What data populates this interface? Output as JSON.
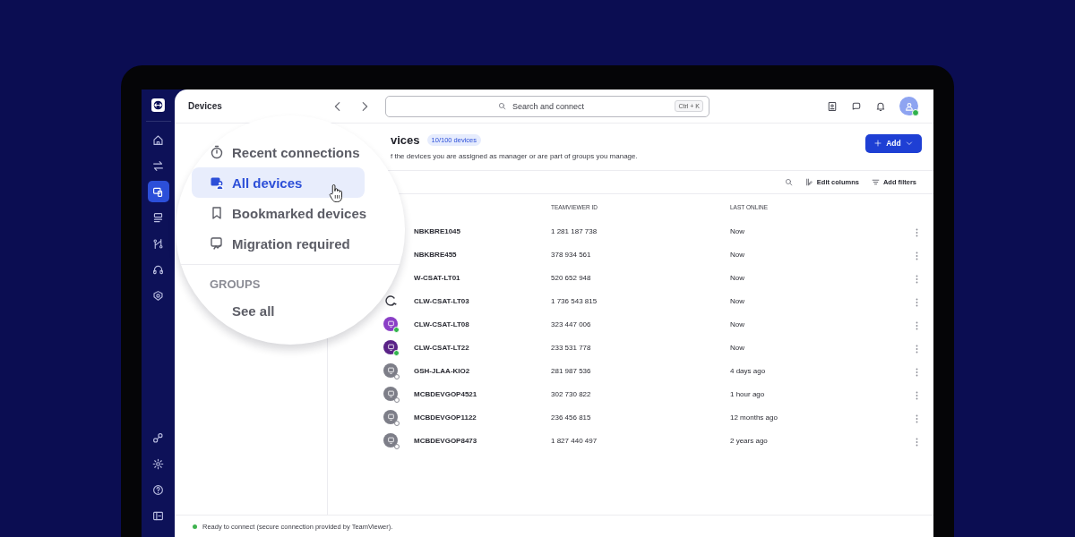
{
  "header": {
    "title": "Devices",
    "search": {
      "placeholder": "Search and connect",
      "shortcut": "Ctrl + K"
    },
    "avatar": {
      "online": true
    }
  },
  "rail": {
    "top": [
      {
        "selected": false
      },
      {
        "selected": false
      },
      {
        "selected": true
      },
      {
        "selected": false
      },
      {
        "selected": false
      },
      {
        "selected": false
      },
      {
        "selected": false
      }
    ],
    "bottom": [
      {
        "selected": false
      },
      {
        "selected": false
      },
      {
        "selected": false
      },
      {
        "selected": false
      }
    ]
  },
  "magnifier": {
    "items": [
      {
        "label": "Recent connections",
        "selected": false
      },
      {
        "label": "All devices",
        "selected": true
      },
      {
        "label": "Bookmarked devices",
        "selected": false
      },
      {
        "label": "Migration required",
        "selected": false
      }
    ],
    "section": "GROUPS",
    "see_all": "See all"
  },
  "content": {
    "title": "vices",
    "badge": "10/100 devices",
    "subtitle": "f the devices you are assigned as manager or are part of groups you manage.",
    "add_button": "Add",
    "toolbar": [
      {
        "kind": "edit",
        "label": "Edit columns"
      },
      {
        "kind": "filter",
        "label": "Add filters"
      }
    ]
  },
  "table": {
    "columns": [
      "TEAMVIEWER ID",
      "LAST ONLINE"
    ],
    "rows": [
      {
        "name": "NBKBRE1045",
        "kind": "none",
        "id": "1 281 187 738",
        "last_online": "Now"
      },
      {
        "name": "NBKBRE455",
        "kind": "none",
        "id": "378 934 561",
        "last_online": "Now"
      },
      {
        "name": "W-CSAT-LT01",
        "kind": "none",
        "id": "520 652 948",
        "last_online": "Now"
      },
      {
        "name": "CLW-CSAT-LT03",
        "kind": "syncing",
        "id": "1 736 543 815",
        "last_online": "Now"
      },
      {
        "name": "CLW-CSAT-LT08",
        "kind": "device",
        "color": "#8a3fc6",
        "online": true,
        "id": "323 447 006",
        "last_online": "Now"
      },
      {
        "name": "CLW-CSAT-LT22",
        "kind": "device",
        "color": "#5a2387",
        "online": true,
        "id": "233 531 778",
        "last_online": "Now"
      },
      {
        "name": "GSH-JLAA-KIO2",
        "kind": "device",
        "color": "#7d7e88",
        "online": false,
        "id": "281 987 536",
        "last_online": "4 days ago"
      },
      {
        "name": "MCBDEVGOP4521",
        "kind": "device",
        "color": "#7d7e88",
        "online": false,
        "id": "302 730 822",
        "last_online": "1 hour ago"
      },
      {
        "name": "MCBDEVGOP1122",
        "kind": "device",
        "color": "#7d7e88",
        "online": false,
        "id": "236 456 815",
        "last_online": "12 months ago"
      },
      {
        "name": "MCBDEVGOP8473",
        "kind": "device",
        "color": "#7d7e88",
        "online": false,
        "id": "1 827 440 497",
        "last_online": "2 years ago"
      }
    ]
  },
  "status_bar": {
    "text": "Ready to connect (secure connection provided by TeamViewer).",
    "connected": true
  }
}
